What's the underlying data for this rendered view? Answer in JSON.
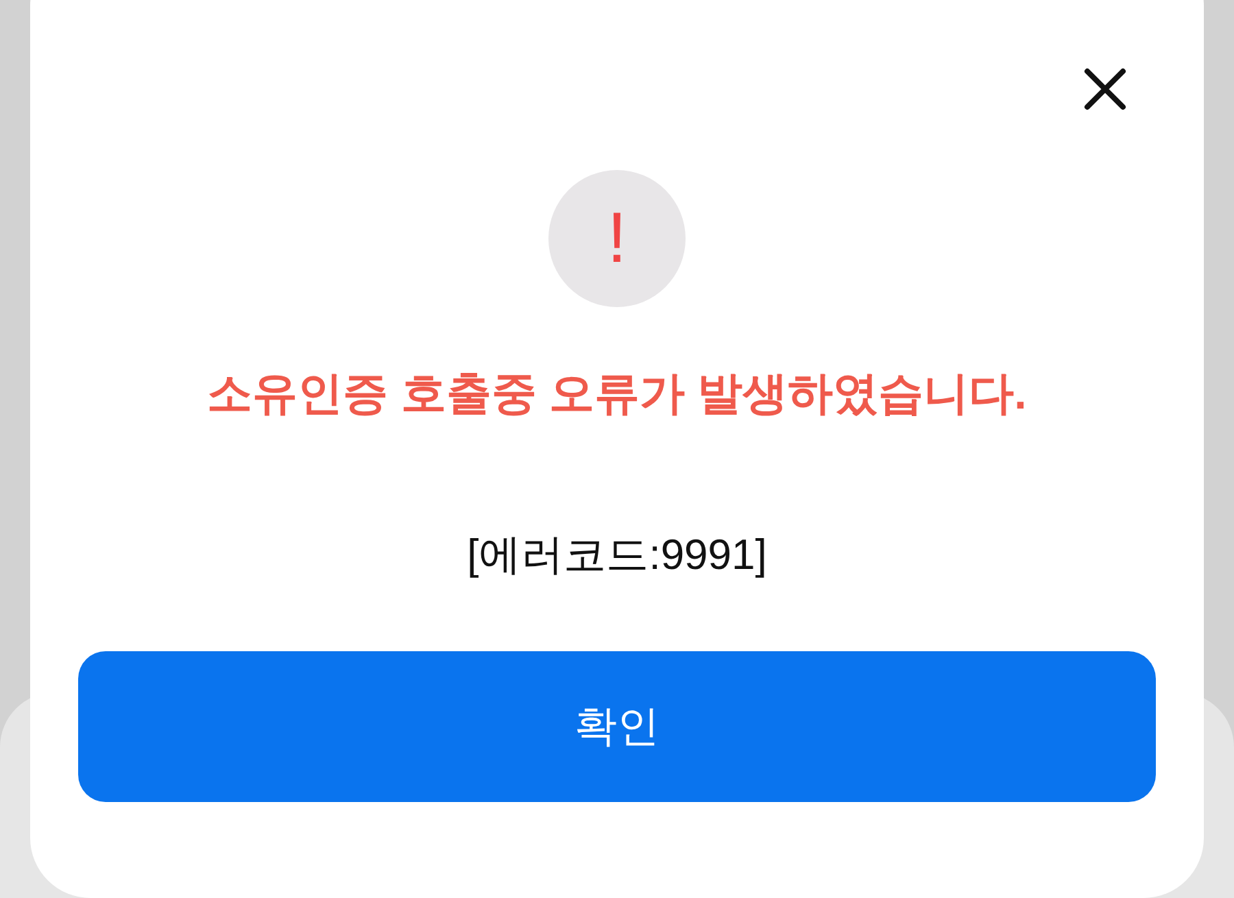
{
  "dialog": {
    "message": "소유인증 호출중 오류가 발생하였습니다.",
    "error_code": "[에러코드:9991]",
    "alert_symbol": "!",
    "button": {
      "label": "확인"
    }
  }
}
